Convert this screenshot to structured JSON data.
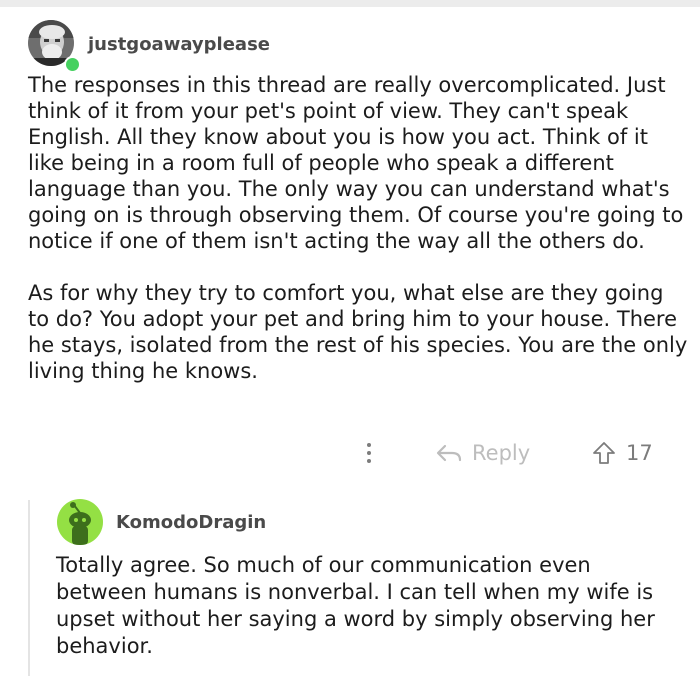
{
  "comment": {
    "author": "justgoawayplease",
    "avatar_icon": "user-photo-avatar",
    "online": true,
    "paragraphs": [
      "The responses in this thread are really overcomplicated. Just think of it from your pet's point of view. They can't speak English. All they know about you is how you act. Think of it like being in a room full of people who speak a different language than you. The only way you can understand what's going on is through observing them. Of course you're going to notice if one of them isn't acting the way all the others do.",
      "As for why they try to comfort you, what else are they going to do? You adopt your pet and bring him to your house. There he stays, isolated from the rest of his species. You are the only living thing he knows."
    ],
    "actions": {
      "more_icon": "vertical-ellipsis-icon",
      "reply_icon": "reply-arrow-icon",
      "reply_label": "Reply",
      "upvote_icon": "upvote-arrow-icon",
      "score": "17"
    }
  },
  "reply": {
    "author": "KomodoDragin",
    "avatar_icon": "snoo-avatar",
    "avatar_color": "#94e044",
    "body": "Totally agree.  So much of our communication even between humans is nonverbal.  I can tell when my wife is upset without her saying a word by simply observing her behavior."
  }
}
